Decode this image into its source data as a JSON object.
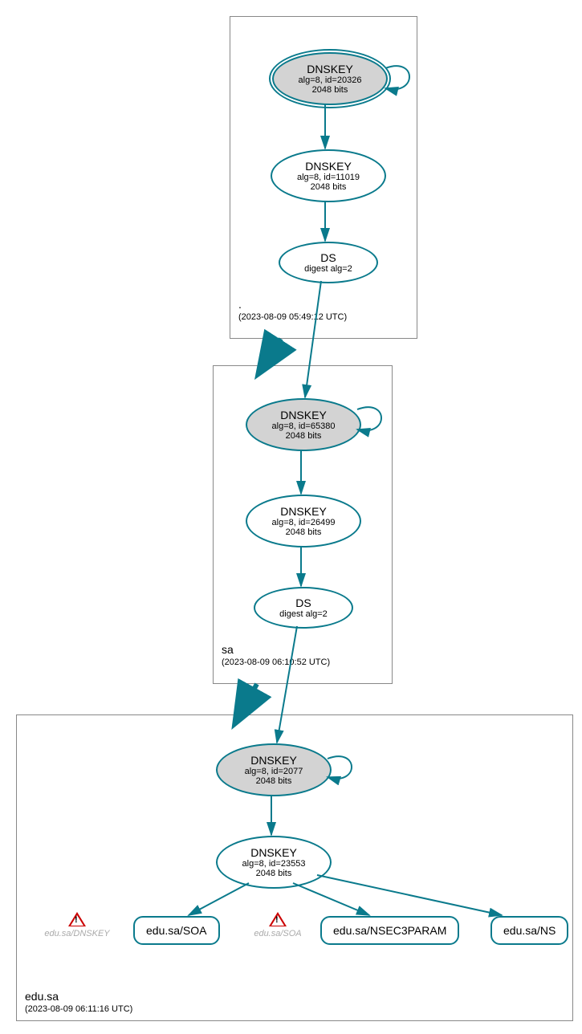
{
  "zones": {
    "root": {
      "name": ".",
      "timestamp": "(2023-08-09 05:49:12 UTC)",
      "nodes": {
        "ksk": {
          "title": "DNSKEY",
          "line1": "alg=8, id=20326",
          "line2": "2048 bits"
        },
        "zsk": {
          "title": "DNSKEY",
          "line1": "alg=8, id=11019",
          "line2": "2048 bits"
        },
        "ds": {
          "title": "DS",
          "line1": "digest alg=2"
        }
      }
    },
    "sa": {
      "name": "sa",
      "timestamp": "(2023-08-09 06:10:52 UTC)",
      "nodes": {
        "ksk": {
          "title": "DNSKEY",
          "line1": "alg=8, id=65380",
          "line2": "2048 bits"
        },
        "zsk": {
          "title": "DNSKEY",
          "line1": "alg=8, id=26499",
          "line2": "2048 bits"
        },
        "ds": {
          "title": "DS",
          "line1": "digest alg=2"
        }
      }
    },
    "edusa": {
      "name": "edu.sa",
      "timestamp": "(2023-08-09 06:11:16 UTC)",
      "nodes": {
        "ksk": {
          "title": "DNSKEY",
          "line1": "alg=8, id=2077",
          "line2": "2048 bits"
        },
        "zsk": {
          "title": "DNSKEY",
          "line1": "alg=8, id=23553",
          "line2": "2048 bits"
        }
      },
      "records": {
        "soa": "edu.sa/SOA",
        "nsec3": "edu.sa/NSEC3PARAM",
        "ns": "edu.sa/NS"
      },
      "warnings": {
        "dnskey": "edu.sa/DNSKEY",
        "soa": "edu.sa/SOA"
      }
    }
  }
}
